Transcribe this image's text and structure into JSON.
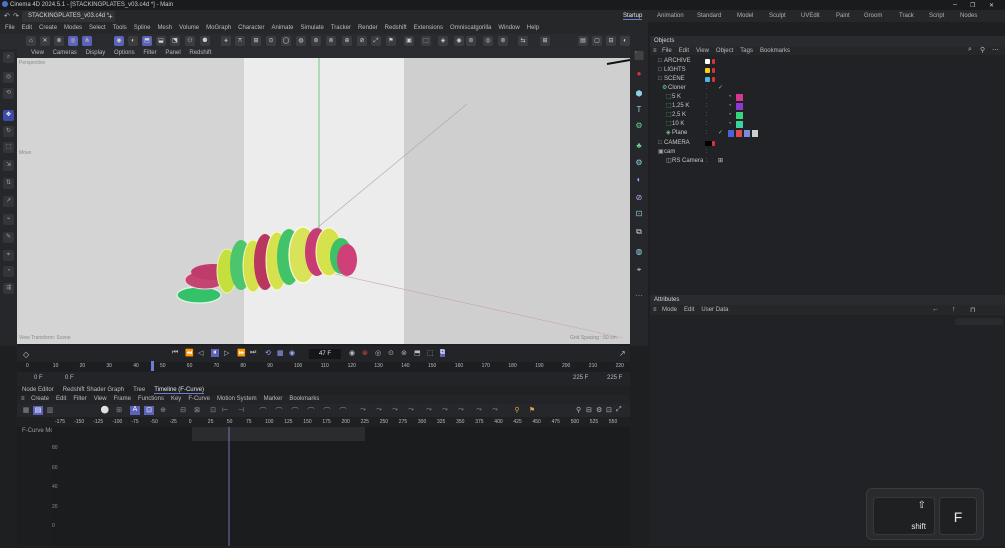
{
  "window": {
    "title": "Cinema 4D 2024.5.1 - [STACKINGPLATES_v03.c4d *] - Main",
    "min_glyph": "–",
    "max_glyph": "❐",
    "close_glyph": "✕"
  },
  "tabs": {
    "doc": "STACKINGPLATES_v03.c4d *",
    "add": "+",
    "layouts": [
      "Startup",
      "Animation",
      "Standard",
      "Model",
      "Sculpt",
      "UVEdit",
      "Paint",
      "Groom",
      "Track",
      "Script",
      "Nodes"
    ],
    "active_layout": "Startup"
  },
  "menu": [
    "File",
    "Edit",
    "Create",
    "Modes",
    "Select",
    "Tools",
    "Spline",
    "Mesh",
    "Volume",
    "MoGraph",
    "Character",
    "Animate",
    "Simulate",
    "Tracker",
    "Render",
    "Redshift",
    "Extensions",
    "Omniscatgorilla",
    "Window",
    "Help"
  ],
  "viewport": {
    "menu": [
      "View",
      "Cameras",
      "Display",
      "Options",
      "Filter",
      "Panel",
      "Redshift"
    ],
    "label_tl": "Perspective",
    "label_mid": "Move",
    "label_bl": "View Transform: Scene",
    "label_br": "Grid Spacing : 50 cm"
  },
  "timeline": {
    "frame_field": "47 F",
    "start_value": "0 F",
    "start_value2": "0 F",
    "end_value": "225 F",
    "end_value2": "225 F",
    "ruler": [
      "0",
      "10",
      "20",
      "30",
      "40",
      "50",
      "60",
      "70",
      "80",
      "90",
      "100",
      "110",
      "120",
      "130",
      "140",
      "150",
      "160",
      "170",
      "180",
      "190",
      "200",
      "210",
      "220"
    ]
  },
  "editor_tabs": [
    "Node Editor",
    "Redshift Shader Graph",
    "Tree",
    "Timeline (F-Curve)"
  ],
  "active_editor_tab": "Timeline (F-Curve)",
  "fcurve": {
    "menu": [
      "Create",
      "Edit",
      "Filter",
      "View",
      "Frame",
      "Functions",
      "Key",
      "F-Curve",
      "Motion System",
      "Marker",
      "Bookmarks"
    ],
    "ruler": [
      "-175",
      "-150",
      "-125",
      "-100",
      "-75",
      "-50",
      "-25",
      "0",
      "25",
      "50",
      "75",
      "100",
      "125",
      "150",
      "175",
      "200",
      "225",
      "250",
      "275",
      "300",
      "325",
      "350",
      "375",
      "400",
      "425",
      "450",
      "475",
      "500",
      "525",
      "550"
    ],
    "mode_label": "F-Curve Mo",
    "y_labels": [
      "80",
      "60",
      "40",
      "20",
      "0"
    ]
  },
  "objects": {
    "title": "Objects",
    "menu": [
      "File",
      "Edit",
      "View",
      "Object",
      "Tags",
      "Bookmarks"
    ],
    "rows": [
      {
        "name": "ARCHIVE",
        "color": "#ffffff"
      },
      {
        "name": "LIGHTS",
        "color": "#f2d21b"
      },
      {
        "name": "SCENE",
        "color": "#4fb4e6"
      },
      {
        "name": "Cloner",
        "color": ""
      },
      {
        "name": "5 K",
        "color": ""
      },
      {
        "name": "1,25 K",
        "color": ""
      },
      {
        "name": "2,5 K",
        "color": ""
      },
      {
        "name": "10 K",
        "color": ""
      },
      {
        "name": "Plane",
        "color": ""
      },
      {
        "name": "CAMERA",
        "color": "#111111"
      },
      {
        "name": "cam",
        "color": ""
      },
      {
        "name": "RS Camera",
        "color": ""
      }
    ]
  },
  "attributes": {
    "title": "Attributes",
    "menu": [
      "Mode",
      "Edit",
      "User Data"
    ]
  },
  "keyboard": {
    "key1_label": "shift",
    "key1_glyph": "⇧",
    "key2_label": "F"
  },
  "colors": {
    "accent": "#5b62b8",
    "viewport_bg": "#d8d8d8",
    "wall": "#ececec"
  }
}
